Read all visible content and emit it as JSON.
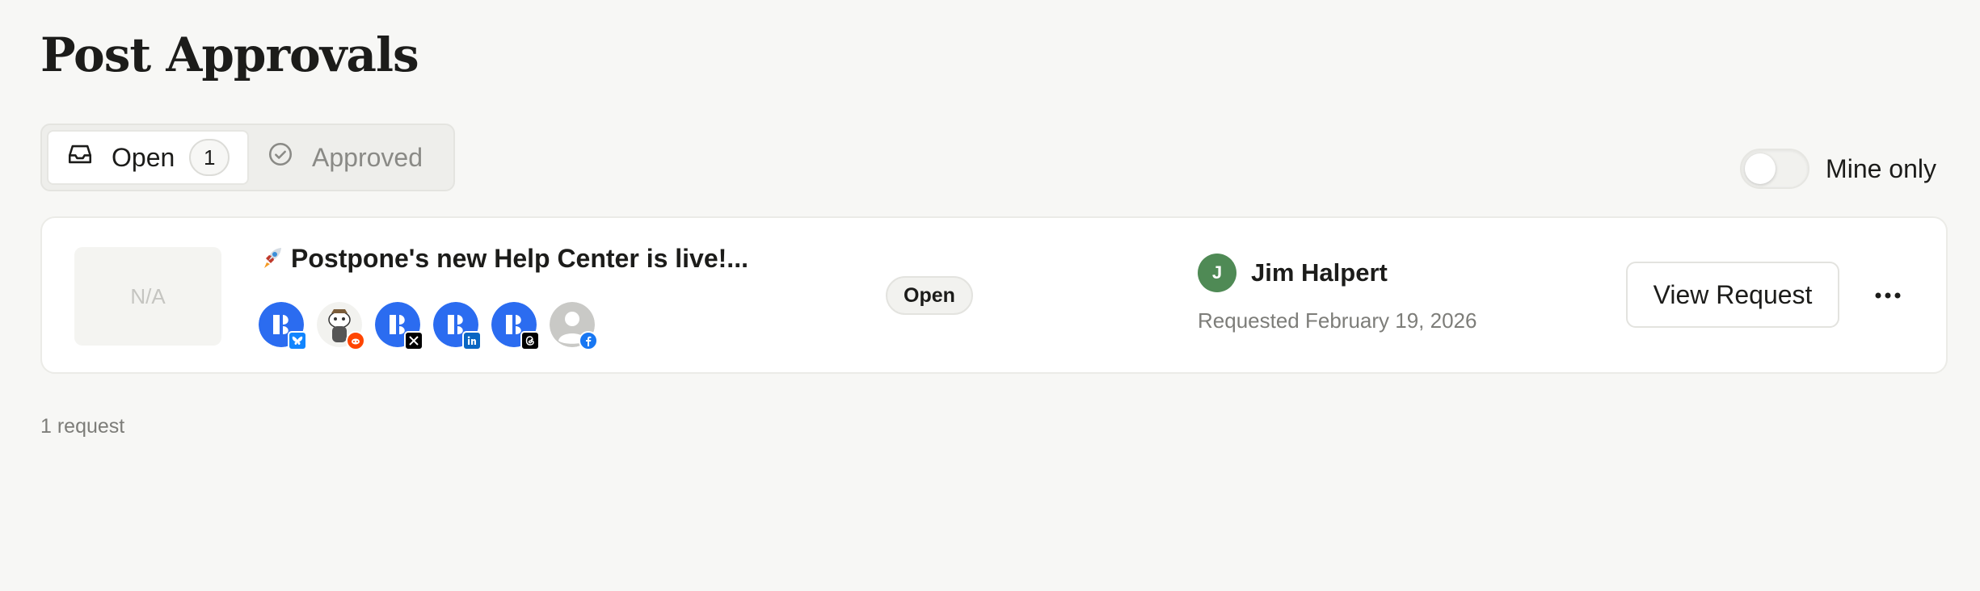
{
  "page": {
    "title": "Post Approvals"
  },
  "tabs": [
    {
      "label": "Open",
      "count": "1",
      "icon": "inbox-icon",
      "active": true
    },
    {
      "label": "Approved",
      "icon": "check-circle-icon",
      "active": false
    }
  ],
  "filter": {
    "label": "Mine only",
    "enabled": false
  },
  "requests": [
    {
      "thumbnail": "N/A",
      "title": "Postpone's new Help Center is live!...",
      "title_icon": "rocket-icon",
      "accounts": [
        {
          "network": "bluesky",
          "badge_color": "#1185fe"
        },
        {
          "network": "reddit",
          "badge_color": "#ff4500"
        },
        {
          "network": "x",
          "badge_color": "#000000"
        },
        {
          "network": "linkedin",
          "badge_color": "#0a66c2"
        },
        {
          "network": "threads",
          "badge_color": "#000000"
        },
        {
          "network": "facebook",
          "badge_color": "#1877f2"
        }
      ],
      "status": "Open",
      "requester": {
        "initial": "J",
        "name": "Jim Halpert",
        "avatar_color": "#4f8a55"
      },
      "requested": "Requested February 19, 2026",
      "action_label": "View Request"
    }
  ],
  "footer": {
    "count_text": "1 request"
  },
  "colors": {
    "brand_blue": "#2b6cf0",
    "background": "#f7f7f5"
  }
}
